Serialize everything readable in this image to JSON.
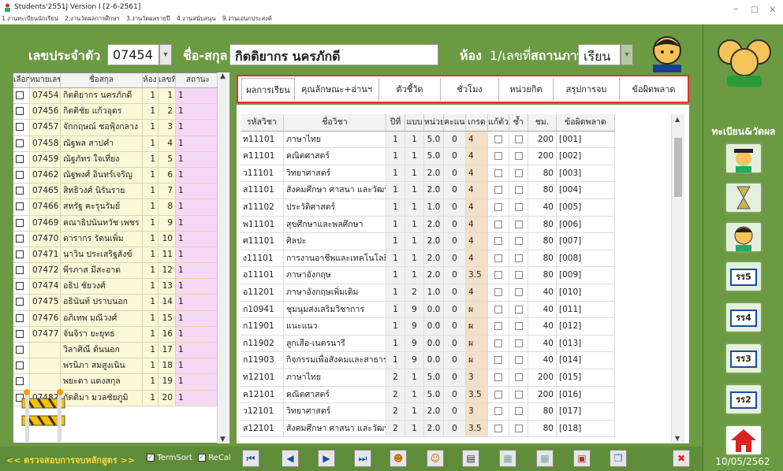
{
  "app": {
    "title": "Students'2551J Version I [2-6-2561]",
    "minimize": "–",
    "maximize": "☐",
    "close": "✕"
  },
  "menu": [
    "1.งานทะเบียนนักเรียน",
    "2.งานวัดผลการศึกษา",
    "3.งานวัดผลรายปี",
    "4.งานสนับสนุน",
    "9.งานเอนกประสงค์"
  ],
  "header": {
    "id_label": "เลขประจำตัว",
    "id_value": "07454",
    "name_label": "ชื่อ-สกุล",
    "name_value": "กิตติยากร  นครภักดี",
    "room_label": "ห้อง",
    "room_value": "1/เลขที่",
    "status_label": "สถานภาพ",
    "status_value": "เรียน"
  },
  "student_grid": {
    "headers": [
      "เลือก",
      "หมายเลข",
      "ชื่อสกุล",
      "ห้อง",
      "เลขที่",
      "สถานะ"
    ],
    "rows": [
      {
        "id": "07454",
        "name": "กิตติยากร  นครภักดี",
        "room": "1",
        "no": "1",
        "status": "1"
      },
      {
        "id": "07456",
        "name": "กิตติชัย  แก้วอุดร",
        "room": "1",
        "no": "2",
        "status": "1"
      },
      {
        "id": "07457",
        "name": "จักกฤษณ์  ชอฟุ้งกลาง",
        "room": "1",
        "no": "3",
        "status": "1"
      },
      {
        "id": "07458",
        "name": "ณัฐพล  สาปคำ",
        "room": "1",
        "no": "4",
        "status": "1"
      },
      {
        "id": "07459",
        "name": "ณัฐภัทร  ใจเที่ยง",
        "room": "1",
        "no": "5",
        "status": "1"
      },
      {
        "id": "07462",
        "name": "ณัฐพงศ์  อินทร์เจริญ",
        "room": "1",
        "no": "6",
        "status": "1"
      },
      {
        "id": "07465",
        "name": "สิทธิวงศ์  นิรันราย",
        "room": "1",
        "no": "7",
        "status": "1"
      },
      {
        "id": "07466",
        "name": "สหรัฐ  คะรุนรัมย์",
        "room": "1",
        "no": "8",
        "status": "1"
      },
      {
        "id": "07469",
        "name": "คณาธิปนันทวัช  เพชร",
        "room": "1",
        "no": "9",
        "status": "1"
      },
      {
        "id": "07470",
        "name": "ดารากร  รัตนเพิ่ม",
        "room": "1",
        "no": "10",
        "status": "1"
      },
      {
        "id": "07471",
        "name": "นาวิน  ประเสริฐสังข์",
        "room": "1",
        "no": "11",
        "status": "1"
      },
      {
        "id": "07472",
        "name": "พีรภาส  มีสะอาด",
        "room": "1",
        "no": "12",
        "status": "1"
      },
      {
        "id": "07474",
        "name": "อธิป  ชัยวงศ์",
        "room": "1",
        "no": "13",
        "status": "1"
      },
      {
        "id": "07475",
        "name": "อธินันท์  ปราบนอก",
        "room": "1",
        "no": "14",
        "status": "1"
      },
      {
        "id": "07476",
        "name": "อภิเทพ  มณีวงศ์",
        "room": "1",
        "no": "15",
        "status": "1"
      },
      {
        "id": "07477",
        "name": "จันจิรา  ยะยุทธ",
        "room": "1",
        "no": "16",
        "status": "1"
      },
      {
        "id": "",
        "name": "วิลาศิณี  ต้นนอก",
        "room": "1",
        "no": "17",
        "status": "1"
      },
      {
        "id": "",
        "name": "พรนิภา  สมสูงเนิน",
        "room": "1",
        "no": "18",
        "status": "1"
      },
      {
        "id": "",
        "name": "พยะดา  แดงสกุล",
        "room": "1",
        "no": "19",
        "status": "1"
      },
      {
        "id": "07482",
        "name": "กัตติมา  มวลชัยภูมิ",
        "room": "1",
        "no": "20",
        "status": "1"
      }
    ]
  },
  "tabs": [
    "ผลการเรียน",
    "คุณลักษณะ+อ่านฯ",
    "ตัวชี้วัด",
    "ชั่วโมง",
    "หน่วยกิต",
    "สรุปการจบ",
    "ข้อผิดพลาด"
  ],
  "grades": {
    "headers": [
      "รหัสวิชา",
      "ชื่อวิชา",
      "ปีที่",
      "แบบ",
      "หน่วย",
      "คะแนน",
      "เกรด",
      "แก้ตัว",
      "ซ้ำ",
      "ชม.",
      "ข้อผิดพลาด"
    ],
    "rows": [
      {
        "code": "ท11101",
        "name": "ภาษาไทย",
        "year": "1",
        "type": "1",
        "unit": "5.0",
        "score": "0",
        "grade": "4",
        "hours": "200",
        "err": "[001]"
      },
      {
        "code": "ค11101",
        "name": "คณิตศาสตร์",
        "year": "1",
        "type": "1",
        "unit": "5.0",
        "score": "0",
        "grade": "4",
        "hours": "200",
        "err": "[002]"
      },
      {
        "code": "ว11101",
        "name": "วิทยาศาสตร์",
        "year": "1",
        "type": "1",
        "unit": "2.0",
        "score": "0",
        "grade": "4",
        "hours": "80",
        "err": "[003]"
      },
      {
        "code": "ส11101",
        "name": "สังคมศึกษา ศาสนา และวัฒนธ",
        "year": "1",
        "type": "1",
        "unit": "2.0",
        "score": "0",
        "grade": "4",
        "hours": "80",
        "err": "[004]"
      },
      {
        "code": "ส11102",
        "name": "ประวัติศาสตร์",
        "year": "1",
        "type": "1",
        "unit": "1.0",
        "score": "0",
        "grade": "4",
        "hours": "40",
        "err": "[005]"
      },
      {
        "code": "พ11101",
        "name": "สุขศึกษาและพลศึกษา",
        "year": "1",
        "type": "1",
        "unit": "2.0",
        "score": "0",
        "grade": "4",
        "hours": "80",
        "err": "[006]"
      },
      {
        "code": "ศ11101",
        "name": "ศิลปะ",
        "year": "1",
        "type": "1",
        "unit": "2.0",
        "score": "0",
        "grade": "4",
        "hours": "80",
        "err": "[007]"
      },
      {
        "code": "ง11101",
        "name": "การงานอาชีพและเทคโนโลยี",
        "year": "1",
        "type": "1",
        "unit": "2.0",
        "score": "0",
        "grade": "4",
        "hours": "80",
        "err": "[008]"
      },
      {
        "code": "อ11101",
        "name": "ภาษาอังกฤษ",
        "year": "1",
        "type": "1",
        "unit": "2.0",
        "score": "0",
        "grade": "3.5",
        "hours": "80",
        "err": "[009]"
      },
      {
        "code": "อ11201",
        "name": "ภาษาอังกฤษเพิ่มเติม",
        "year": "1",
        "type": "2",
        "unit": "1.0",
        "score": "0",
        "grade": "4",
        "hours": "40",
        "err": "[010]"
      },
      {
        "code": "ก10941",
        "name": "ชุมนุมส่งเสริมวิชาการ",
        "year": "1",
        "type": "9",
        "unit": "0.0",
        "score": "0",
        "grade": "ผ",
        "hours": "40",
        "err": "[011]"
      },
      {
        "code": "ก11901",
        "name": "แนะแนว",
        "year": "1",
        "type": "9",
        "unit": "0.0",
        "score": "0",
        "grade": "ผ",
        "hours": "40",
        "err": "[012]"
      },
      {
        "code": "ก11902",
        "name": "ลูกเสือ-เนตรนารี",
        "year": "1",
        "type": "9",
        "unit": "0.0",
        "score": "0",
        "grade": "ผ",
        "hours": "40",
        "err": "[013]"
      },
      {
        "code": "ก11903",
        "name": "กิจกรรมเพื่อสังคมและสาธารณ",
        "year": "1",
        "type": "9",
        "unit": "0.0",
        "score": "0",
        "grade": "ผ",
        "hours": "40",
        "err": "[014]"
      },
      {
        "code": "ท12101",
        "name": "ภาษาไทย",
        "year": "2",
        "type": "1",
        "unit": "5.0",
        "score": "0",
        "grade": "3",
        "hours": "200",
        "err": "[015]"
      },
      {
        "code": "ค12101",
        "name": "คณิตศาสตร์",
        "year": "2",
        "type": "1",
        "unit": "5.0",
        "score": "0",
        "grade": "3.5",
        "hours": "200",
        "err": "[016]"
      },
      {
        "code": "ว12101",
        "name": "วิทยาศาสตร์",
        "year": "2",
        "type": "1",
        "unit": "2.0",
        "score": "0",
        "grade": "3",
        "hours": "80",
        "err": "[017]"
      },
      {
        "code": "ส12101",
        "name": "สังคมศึกษา ศาสนา และวัฒนธ",
        "year": "2",
        "type": "1",
        "unit": "2.0",
        "score": "0",
        "grade": "3.5",
        "hours": "80",
        "err": "[018]"
      }
    ]
  },
  "bottom": {
    "check_link": "<< ตรวจสอบการจบหลักสูตร >>",
    "termsort": "TermSort",
    "recal": "ReCal"
  },
  "sidebar": {
    "title": "ทะเบียน&วัดผล",
    "btn1": "ร.ร.5",
    "btn2": "ร.ร.4",
    "btn3": "ร.ร.3",
    "btn4": "ร.ร.2",
    "b1": "รร5",
    "b2": "รร4",
    "b3": "รร3",
    "b4": "รร2",
    "date": "10/05/2562"
  },
  "colors": {
    "bg_green": "#6b9a42",
    "tab_border": "#dd3333"
  }
}
